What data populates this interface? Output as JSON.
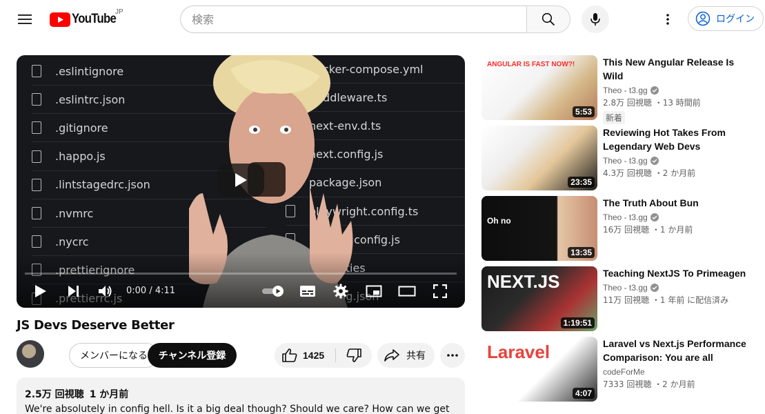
{
  "header": {
    "logo_text": "YouTube",
    "country_code": "JP",
    "search_placeholder": "検索",
    "login_label": "ログイン"
  },
  "player": {
    "files_left": [
      ".eslintignore",
      ".eslintrc.json",
      ".gitignore",
      ".happo.js",
      ".lintstagedrc.json",
      ".nvmrc",
      ".nycrc",
      ".prettierignore",
      ".prettierrc.js"
    ],
    "files_right": [
      "docker-compose.yml",
      "middleware.ts",
      "next-env.d.ts",
      "next.config.js",
      "package.json",
      "playwright.config.ts",
      "postcss.config.js",
      "properties",
      "tsconfig.json"
    ],
    "time_display": "0:00 / 4:11",
    "progress_fraction": 0
  },
  "video": {
    "title": "JS Devs Deserve Better",
    "member_label": "メンバーになる",
    "subscribe_label": "チャンネル登録",
    "like_count": "1425",
    "share_label": "共有",
    "views": "2.5万 回視聴",
    "age": "1 か月前",
    "description": "We're absolutely in config hell. Is it a big deal though? Should we care? How can we get out?"
  },
  "recommendations": [
    {
      "title": "This New Angular Release Is Wild",
      "channel": "Theo - t3.gg",
      "verified": true,
      "stats": "2.8万 回視聴 ・13 時間前",
      "badge": "新着",
      "duration": "5:53",
      "thumb_text": "ANGULAR IS FAST NOW?!"
    },
    {
      "title": "Reviewing Hot Takes From Legendary Web Devs",
      "channel": "Theo - t3.gg",
      "verified": true,
      "stats": "4.3万 回視聴 ・2 か月前",
      "badge": "",
      "duration": "23:35",
      "thumb_text": ""
    },
    {
      "title": "The Truth About Bun",
      "channel": "Theo - t3.gg",
      "verified": true,
      "stats": "16万 回視聴 ・1 か月前",
      "badge": "",
      "duration": "13:35",
      "thumb_text": "Oh no"
    },
    {
      "title": "Teaching NextJS To Primeagen",
      "channel": "Theo - t3.gg",
      "verified": true,
      "stats": "11万 回視聴 ・1 年前 に配信済み",
      "badge": "",
      "duration": "1:19:51",
      "thumb_text": "NEXT.JS"
    },
    {
      "title": "Laravel vs Next.js Performance Comparison: You are all wrong!",
      "channel": "codeForMe",
      "verified": false,
      "stats": "7333 回視聴 ・2 か月前",
      "badge": "",
      "duration": "4:07",
      "thumb_text": "Laravel"
    }
  ],
  "colors": {
    "brand_red": "#ff0000",
    "link_blue": "#065fd4",
    "chip_bg": "#f2f2f2"
  }
}
